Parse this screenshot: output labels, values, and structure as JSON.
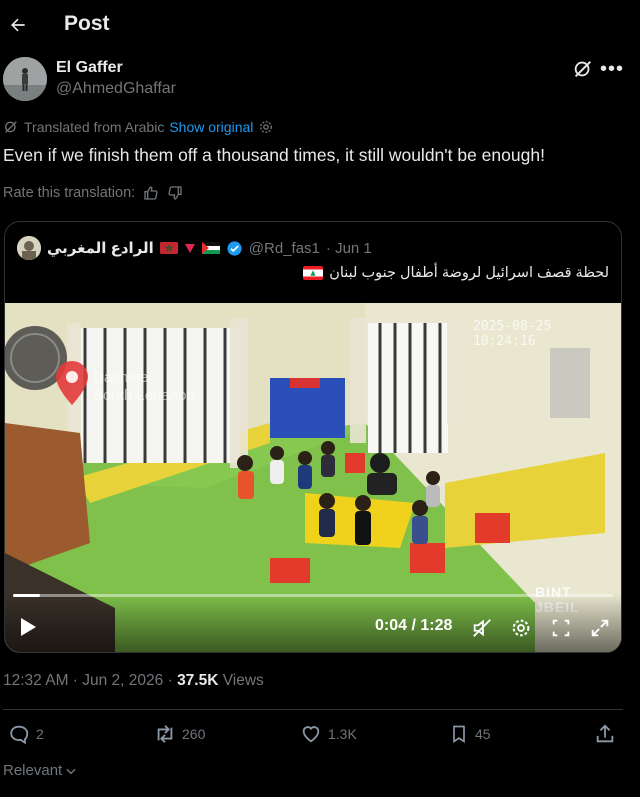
{
  "header": {
    "title": "Post"
  },
  "author": {
    "name": "El Gaffer",
    "handle": "@AhmedGhaffar"
  },
  "translation": {
    "note": "Translated from Arabic",
    "show_original": "Show original",
    "rate_label": "Rate this translation:"
  },
  "post": {
    "text": "Even if we finish them off a thousand times, it still wouldn't be enough!"
  },
  "quote": {
    "name": "الرادع المغربي",
    "handle": "@Rd_fas1",
    "date": "· Jun 1",
    "text": "لحظة قصف اسرائيل لروضة أطفال جنوب لبنان",
    "video": {
      "current_time": "0:04",
      "duration": "1:28",
      "progress": 0.045,
      "timestamp_overlay": "2025-08-25 10:24:16",
      "location_overlay": "Dachine\nSouth Lebanon",
      "brand_overlay": "BINT\nJBEIL"
    }
  },
  "meta": {
    "time": "12:32 AM · Jun 2, 2026 · ",
    "views_count": "37.5K",
    "views_label": " Views"
  },
  "actions": {
    "replies": "2",
    "reposts": "260",
    "likes": "1.3K",
    "bookmarks": "45"
  },
  "footer": {
    "sort_label": "Relevant"
  },
  "colors": {
    "accent": "#1d9bf0",
    "muted": "#71767b",
    "text": "#e7e9ea",
    "border": "#2f3336"
  }
}
